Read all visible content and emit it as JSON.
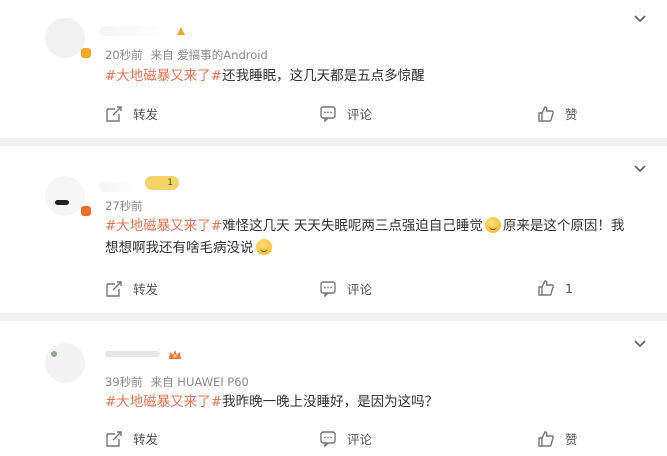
{
  "comments": [
    {
      "time": "20秒前",
      "source": "来自 爱搞事的Android",
      "topic": "#大地磁暴又来了#",
      "text": "还我睡眠，这几天都是五点多惊醒",
      "repost_label": "转发",
      "comment_label": "评论",
      "like_label": "赞"
    },
    {
      "time": "27秒前",
      "source": "",
      "topic": "#大地磁暴又来了#",
      "text_part1": "难怪这几天 天天失眠呢两三点强迫自己睡觉",
      "text_part2": "原来是这个原因！我",
      "text_line2": "想想啊我还有啥毛病没说",
      "repost_label": "转发",
      "comment_label": "评论",
      "like_count": "1",
      "badge_text": "1"
    },
    {
      "time": "39秒前",
      "source": "来自 HUAWEI P60",
      "topic": "#大地磁暴又来了#",
      "text": "我昨晚一晚上没睡好，是因为这吗？",
      "repost_label": "转发",
      "comment_label": "评论",
      "like_label": "赞"
    }
  ],
  "icons": {
    "repost": "repost-icon",
    "comment": "comment-icon",
    "like": "thumbs-up-icon",
    "more": "chevron-down-icon",
    "emoji": "smiley-emoji"
  },
  "colors": {
    "topic": "#eb7350",
    "divider": "#f2f2f5",
    "meta": "#8a8a8a"
  }
}
